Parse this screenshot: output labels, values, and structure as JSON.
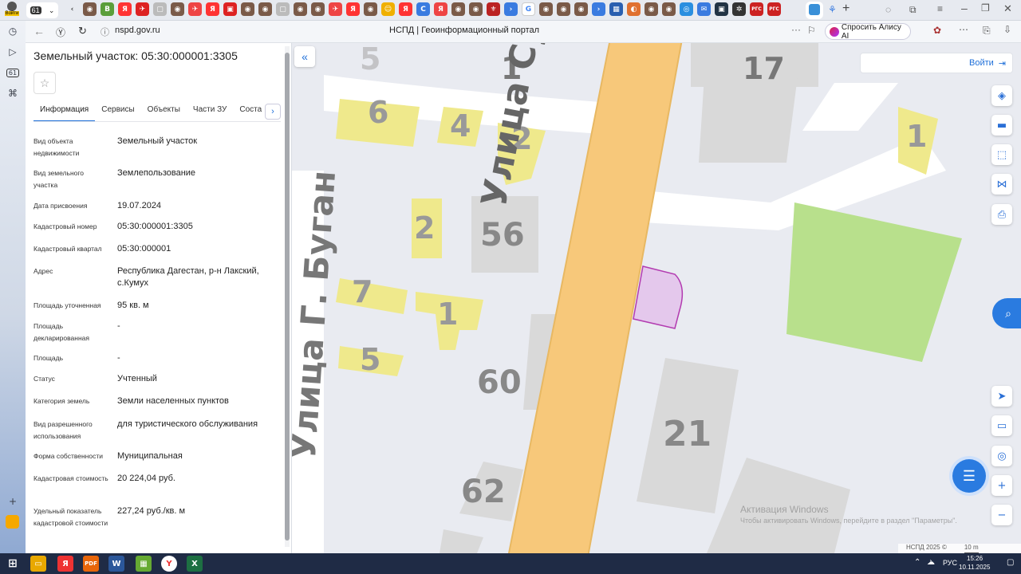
{
  "browser": {
    "address": "nspd.gov.ru",
    "page_title": "НСПД | Геоинформационный портал",
    "alice_label": "Спросить Алису AI",
    "profile_label": "Войти",
    "tab_count_badge": "61",
    "left_badge": "61"
  },
  "panel": {
    "title": "Земельный участок: 05:30:000001:3305",
    "tabs": [
      "Информация",
      "Сервисы",
      "Объекты",
      "Части ЗУ",
      "Соста"
    ],
    "fields": [
      {
        "label": "Вид объекта недвижимости",
        "value": "Земельный участок"
      },
      {
        "label": "Вид земельного участка",
        "value": "Землепользование"
      },
      {
        "label": "Дата присвоения",
        "value": "19.07.2024"
      },
      {
        "label": "Кадастровый номер",
        "value": "05:30:000001:3305"
      },
      {
        "label": "Кадастровый квартал",
        "value": "05:30:000001"
      },
      {
        "label": "Адрес",
        "value": "Республика Дагестан, р-н Лакский, с.Кумух"
      },
      {
        "label": "Площадь уточненная",
        "value": "95 кв. м"
      },
      {
        "label": "Площадь декларированная",
        "value": "-"
      },
      {
        "label": "Площадь",
        "value": "-"
      },
      {
        "label": "Статус",
        "value": "Учтенный"
      },
      {
        "label": "Категория земель",
        "value": "Земли населенных пунктов"
      },
      {
        "label": "Вид разрешенного использования",
        "value": "для туристического обслуживания"
      },
      {
        "label": "Форма собственности",
        "value": "Муниципальная"
      },
      {
        "label": "Кадастровая стоимость",
        "value": "20 224,04 руб."
      },
      {
        "label": "Удельный показатель кадастровой стоимости",
        "value": "227,24 руб./кв. м"
      }
    ]
  },
  "map": {
    "login_label": "Войти",
    "street_main": "Улица Сурх",
    "street_left": "Улица Г. Буган",
    "house_numbers": [
      "5",
      "1",
      "17",
      "6",
      "4",
      "2",
      "1",
      "2",
      "56",
      "7",
      "1",
      "5",
      "60",
      "21",
      "62"
    ],
    "watermark_title": "Активация Windows",
    "watermark_text": "Чтобы активировать Windows, перейдите в раздел \"Параметры\".",
    "copyright": "НСПД 2025 ©",
    "scale": "10 m",
    "colors": {
      "road": "#f7c87a",
      "road_border": "#e8b862",
      "building": "#d9d9d9",
      "building_yellow": "#efe98c",
      "green": "#b8e08c",
      "parcel_fill": "#e4c8ec",
      "parcel_stroke": "#b23bb0"
    }
  },
  "taskbar": {
    "lang": "РУС",
    "time": "15:26",
    "date": "10.11.2025"
  }
}
